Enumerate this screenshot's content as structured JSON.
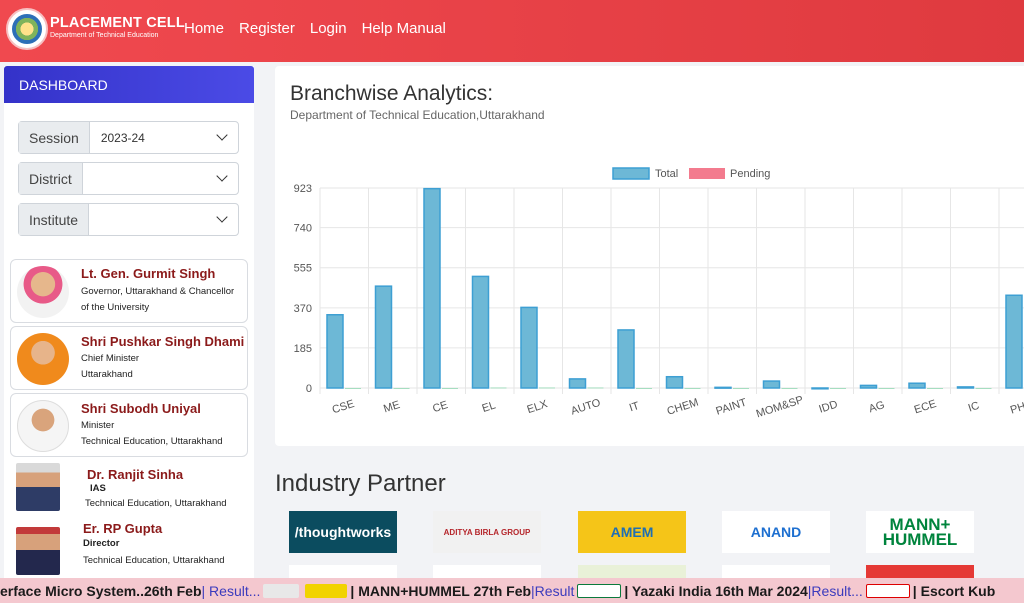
{
  "header": {
    "brand_title": "PLACEMENT CELL",
    "brand_subtitle": "Department of Technical Education",
    "nav": [
      "Home",
      "Register",
      "Login",
      "Help Manual"
    ]
  },
  "sidebar": {
    "dashboard_label": "DASHBOARD",
    "filters": [
      {
        "label": "Session",
        "value": "2023-24"
      },
      {
        "label": "District",
        "value": ""
      },
      {
        "label": "Institute",
        "value": ""
      }
    ],
    "people": [
      {
        "name": "Lt. Gen. Gurmit Singh",
        "line1": "Governor, Uttarakhand & Chancellor",
        "line2": "of the University"
      },
      {
        "name": "Shri Pushkar Singh Dhami",
        "line1": "Chief Minister",
        "line2": "Uttarakhand"
      },
      {
        "name": "Shri Subodh Uniyal",
        "line1": "Minister",
        "line2": "Technical Education, Uttarakhand"
      },
      {
        "name": "Dr. Ranjit Sinha",
        "line1": "IAS",
        "line2": "Technical Education, Uttarakhand"
      },
      {
        "name": "Er. RP Gupta",
        "line1": "Director",
        "line2": "Technical Education, Uttarakhand"
      }
    ]
  },
  "main": {
    "title": "Branchwise Analytics:",
    "subtitle": "Department of Technical Education,Uttarakhand"
  },
  "chart_data": {
    "type": "bar",
    "categories": [
      "CSE",
      "ME",
      "CE",
      "EL",
      "ELX",
      "AUTO",
      "IT",
      "CHEM",
      "PAINT",
      "MOM&SP",
      "IDD",
      "AG",
      "ECE",
      "IC",
      "PHM"
    ],
    "series": [
      {
        "name": "Total",
        "values": [
          338,
          470,
          920,
          515,
          372,
          42,
          268,
          52,
          3,
          32,
          0,
          12,
          22,
          5,
          428
        ]
      },
      {
        "name": "Pending",
        "values": [
          0,
          0,
          0,
          2,
          2,
          2,
          0,
          0,
          0,
          0,
          0,
          0,
          0,
          0,
          0
        ]
      }
    ],
    "y_ticks": [
      0,
      185,
      370,
      555,
      740,
      923
    ],
    "ylim": [
      0,
      923
    ],
    "legend_position": "top-center",
    "grid": true,
    "colors": {
      "Total": "#6db8d6",
      "Total_border": "#3d9fd3",
      "Pending": "#f37b8e"
    }
  },
  "industry": {
    "title": "Industry Partner",
    "logos": [
      {
        "text": "/thoughtworks",
        "bg": "#0b4c5f",
        "color": "#ffffff"
      },
      {
        "text": "ADITYA BIRLA GROUP",
        "bg": "#f1f1f1",
        "color": "#b5262b"
      },
      {
        "text": "AMEM",
        "bg": "#f5c518",
        "color": "#1f6fb5"
      },
      {
        "text": "ANAND",
        "bg": "#ffffff",
        "color": "#1d6fd0"
      },
      {
        "text": "MANN+ HUMMEL",
        "bg": "#ffffff",
        "color": "#00843d"
      }
    ]
  },
  "ticker": [
    {
      "text": "erface Micro System..26th Feb",
      "result": "| Result..."
    },
    {
      "text": "| MANN+HUMMEL 27th Feb",
      "result": "|Result"
    },
    {
      "text": "| Yazaki India 16th Mar 2024",
      "result": "|Result..."
    },
    {
      "text": "| Escort Kub",
      "result": ""
    }
  ]
}
